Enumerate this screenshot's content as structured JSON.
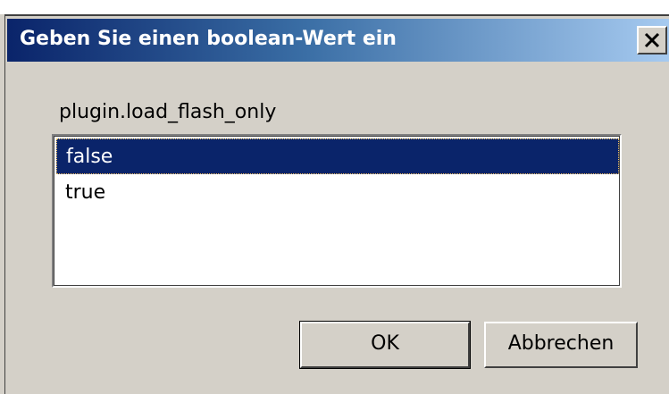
{
  "dialog": {
    "title": "Geben Sie einen boolean-Wert ein",
    "close_icon": "close-icon",
    "pref_name": "plugin.load_flash_only",
    "options": [
      {
        "label": "false",
        "selected": true
      },
      {
        "label": "true",
        "selected": false
      }
    ],
    "ok_label": "OK",
    "cancel_label": "Abbrechen"
  },
  "colors": {
    "title_start": "#0a246a",
    "title_end": "#a6caf0",
    "face": "#d4d0c8",
    "selection": "#0a246a"
  }
}
